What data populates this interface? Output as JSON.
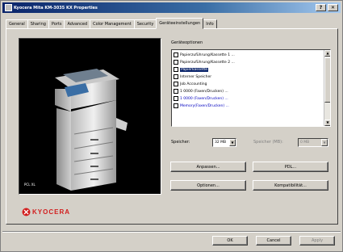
{
  "window": {
    "title": "Kyocera Mita KM-3035 KX Properties",
    "colors": {
      "titlebar": "#0a246a",
      "selection": "#0a246a",
      "brand": "#d21e1e"
    }
  },
  "tabs": [
    {
      "label": "General"
    },
    {
      "label": "Sharing"
    },
    {
      "label": "Ports"
    },
    {
      "label": "Advanced"
    },
    {
      "label": "Color Management"
    },
    {
      "label": "Security"
    },
    {
      "label": "Geräteeinstellungen"
    },
    {
      "label": "Info"
    }
  ],
  "preview": {
    "caption": "PCL XL"
  },
  "brand": {
    "logo": "KYOCERA"
  },
  "options": {
    "label": "Geräteoptionen",
    "items": [
      {
        "label": "Papierzuführung/Kassette 1 ...",
        "icon": "checkbox-icon"
      },
      {
        "label": "Papierzuführung/Kassette 2 ...",
        "icon": "checkbox-icon"
      },
      {
        "label": "Papierkassette",
        "icon": "checkbox-icon",
        "selected": true
      },
      {
        "label": "Interner Speicher",
        "icon": "checkbox-icon"
      },
      {
        "label": "Job Accounting",
        "icon": "checkbox-icon"
      },
      {
        "label": "1 0000 (Faxen/Drucken) ...",
        "icon": "checkbox-icon"
      },
      {
        "label": "1 0000 (Faxen/Drucken) ...",
        "icon": "checkbox-icon",
        "blue": true
      },
      {
        "label": "Memory(Faxen/Drucken) ...",
        "icon": "checkbox-icon",
        "blue": true
      }
    ]
  },
  "memory": {
    "label": "Speicher:",
    "value": "32 MB",
    "unit_label": "Speicher (MB):",
    "unit_value": "0 MB"
  },
  "buttons": {
    "anpassen": "Anpassen...",
    "pdl": "PDL...",
    "optionen": "Optionen...",
    "kompatibilitaet": "Kompatibilität..."
  },
  "footer": {
    "ok": "OK",
    "cancel": "Cancel",
    "apply": "Apply"
  }
}
